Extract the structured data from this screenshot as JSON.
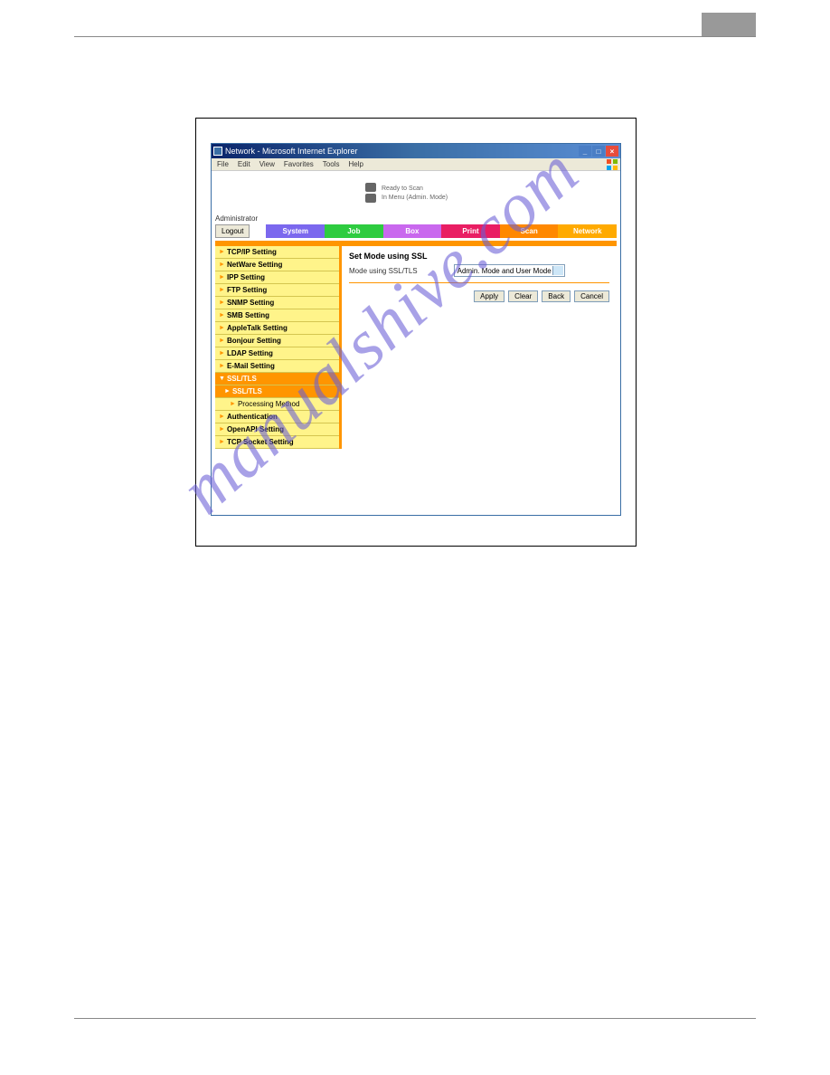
{
  "window": {
    "title": "Network - Microsoft Internet Explorer"
  },
  "menubar": {
    "items": [
      "File",
      "Edit",
      "View",
      "Favorites",
      "Tools",
      "Help"
    ]
  },
  "status": {
    "line1": "Ready to Scan",
    "line2": "In Menu (Admin. Mode)"
  },
  "user_label": "Administrator",
  "logout": "Logout",
  "tabs": {
    "system": "System",
    "job": "Job",
    "box": "Box",
    "print": "Print",
    "scan": "Scan",
    "network": "Network"
  },
  "sidebar": {
    "items": [
      "TCP/IP Setting",
      "NetWare Setting",
      "IPP Setting",
      "FTP Setting",
      "SNMP Setting",
      "SMB Setting",
      "AppleTalk Setting",
      "Bonjour Setting",
      "LDAP Setting",
      "E-Mail Setting"
    ],
    "ssl_parent": "SSL/TLS",
    "ssl_child": "SSL/TLS",
    "processing": "Processing Method",
    "items_after": [
      "Authentication",
      "OpenAPI Setting",
      "TCP Socket Setting"
    ]
  },
  "panel": {
    "title": "Set Mode using SSL",
    "label": "Mode using SSL/TLS",
    "select_value": "Admin. Mode and User Mode",
    "buttons": {
      "apply": "Apply",
      "clear": "Clear",
      "back": "Back",
      "cancel": "Cancel"
    }
  },
  "watermark": "manualshive.com"
}
